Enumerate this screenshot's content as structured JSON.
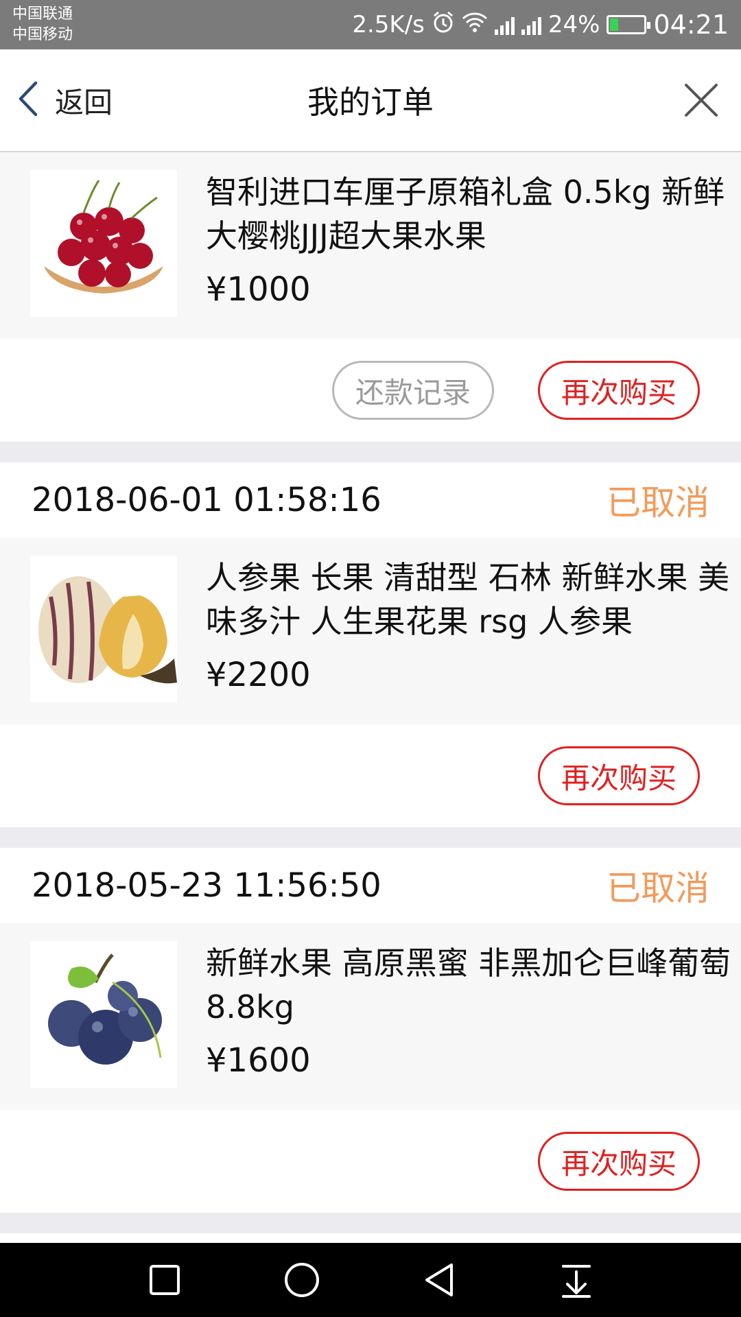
{
  "status_bar": {
    "carrier_1": "中国联通",
    "carrier_2": "中国移动",
    "speed": "2.5K/s",
    "battery": "24%",
    "time": "04:21"
  },
  "nav": {
    "back_label": "返回",
    "title": "我的订单"
  },
  "orders": [
    {
      "date": "",
      "status": "",
      "product_name": "智利进口车厘子原箱礼盒 0.5kg 新鲜大樱桃JJJ超大果水果",
      "price": "¥1000",
      "image_icon": "cherries",
      "repay_label": "还款记录",
      "buy_again_label": "再次购买"
    },
    {
      "date": "2018-06-01 01:58:16",
      "status": "已取消",
      "product_name": "人参果 长果 清甜型 石林 新鲜水果 美味多汁 人生果花果 rsg 人参果",
      "price": "¥2200",
      "image_icon": "pepino-melon",
      "buy_again_label": "再次购买"
    },
    {
      "date": "2018-05-23 11:56:50",
      "status": "已取消",
      "product_name": "新鲜水果 高原黑蜜 非黑加仑巨峰葡萄 8.8kg",
      "price": "¥1600",
      "image_icon": "grapes",
      "buy_again_label": "再次购买"
    }
  ],
  "colors": {
    "accent_red": "#e02020",
    "status_orange": "#f39a5a",
    "statusbar_gray": "#7b7b7b"
  }
}
